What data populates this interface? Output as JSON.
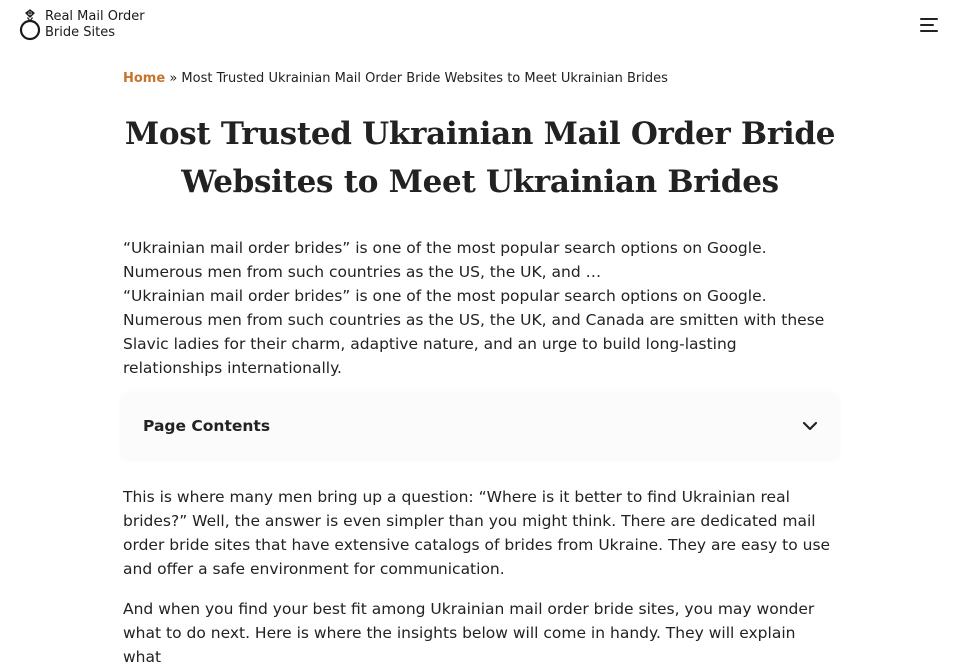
{
  "header": {
    "logo_line1": "Real Mail Order",
    "logo_line2": "Bride Sites",
    "logo_icon": "ring-icon",
    "menu_icon": "hamburger-menu-icon"
  },
  "breadcrumb": {
    "home": "Home",
    "separator": " » ",
    "current": "Most Trusted Ukrainian Mail Order Bride Websites to Meet Ukrainian Brides"
  },
  "article": {
    "title": "Most Trusted Ukrainian Mail Order Bride Websites to Meet Ukrainian Brides",
    "excerpt": "“Ukrainian mail order brides” is one of the most popular search options on Google. Numerous men from such countries as the US, the UK, and …",
    "intro": "“Ukrainian mail order brides” is one of the most popular search options on Google. Numerous men from such countries as the US, the UK, and Canada are smitten with these Slavic ladies for their charm, adaptive nature, and an urge to build long-lasting relationships internationally.",
    "toc_label": "Page Contents",
    "paragraph1": "This is where many men bring up a question: “Where is it better to find Ukrainian real brides?” Well, the answer is even simpler than you might think. There are dedicated mail order bride sites that have extensive catalogs of brides from Ukraine. They are easy to use and offer a safe environment for communication.",
    "paragraph2": "And when you find your best fit among Ukrainian mail order bride sites, you may wonder what to do next. Here is where the insights below will come in handy. They will explain what"
  },
  "colors": {
    "accent": "#c8742a",
    "text": "#222222",
    "toc_bg": "#fbfbfb"
  }
}
